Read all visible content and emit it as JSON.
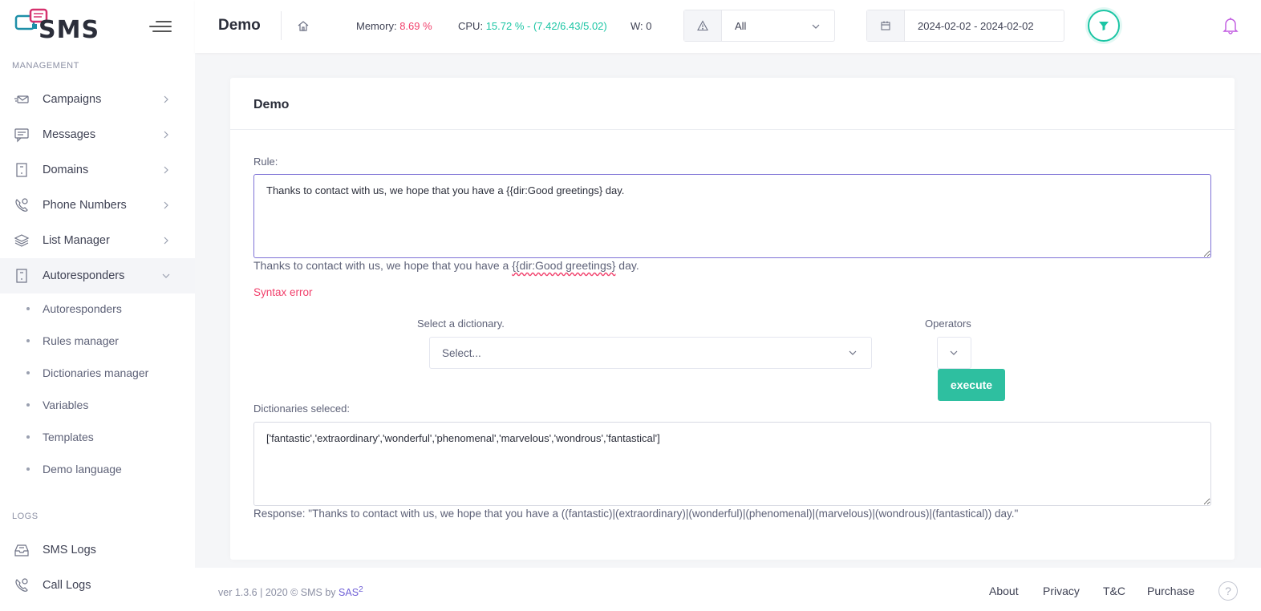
{
  "app": {
    "logo_text": "SMS"
  },
  "sidebar": {
    "section_management": "MANAGEMENT",
    "items": [
      {
        "label": "Campaigns",
        "icon": "megaphone-icon"
      },
      {
        "label": "Messages",
        "icon": "chat-icon"
      },
      {
        "label": "Domains",
        "icon": "building-icon"
      },
      {
        "label": "Phone Numbers",
        "icon": "phone-icon"
      },
      {
        "label": "List Manager",
        "icon": "layers-icon"
      },
      {
        "label": "Autoresponders",
        "icon": "building-icon",
        "expanded": true
      }
    ],
    "sub_items": [
      {
        "label": "Autoresponders"
      },
      {
        "label": "Rules manager"
      },
      {
        "label": "Dictionaries manager"
      },
      {
        "label": "Variables"
      },
      {
        "label": "Templates"
      },
      {
        "label": "Demo language"
      }
    ],
    "section_logs": "LOGS",
    "log_items": [
      {
        "label": "SMS Logs",
        "icon": "inbox-icon"
      },
      {
        "label": "Call Logs",
        "icon": "phone-icon"
      }
    ]
  },
  "header": {
    "title": "Demo",
    "memory_label": "Memory:",
    "memory_value": "8.69 %",
    "cpu_label": "CPU:",
    "cpu_value": "15.72 % - (7.42/6.43/5.02)",
    "w_label": "W: 0",
    "severity_select": "All",
    "date_range": "2024-02-02 - 2024-02-02"
  },
  "card": {
    "title": "Demo",
    "rule_label": "Rule:",
    "rule_value": "Thanks to contact with us, we hope that you have a {{dir:Good greetings} day.",
    "preview_before": "Thanks to contact with us, we hope that you have a ",
    "preview_error_token": "{{dir:Good greetings}",
    "preview_after": " day.",
    "syntax_error": "Syntax error",
    "dictionary_label": "Select a dictionary.",
    "dictionary_placeholder": "Select...",
    "operators_label": "Operators",
    "execute_label": "execute",
    "dictionaries_selected_label": "Dictionaries seleced:",
    "dictionaries_selected_value": "['fantastic','extraordinary','wonderful','phenomenal','marvelous','wondrous','fantastical']",
    "response": "Response: \"Thanks to contact with us, we hope that you have a ((fantastic)|(extraordinary)|(wonderful)|(phenomenal)|(marvelous)|(wondrous)|(fantastical)) day.\""
  },
  "footer": {
    "version": "ver 1.3.6 | 2020 © SMS by ",
    "brand": "SAS",
    "brand_sup": "2",
    "links": [
      "About",
      "Privacy",
      "T&C",
      "Purchase"
    ],
    "help": "?"
  },
  "colors": {
    "accent": "#1bc5a4",
    "error": "#f1416c",
    "brand": "#6f5fd6",
    "bell": "#c058e0"
  }
}
